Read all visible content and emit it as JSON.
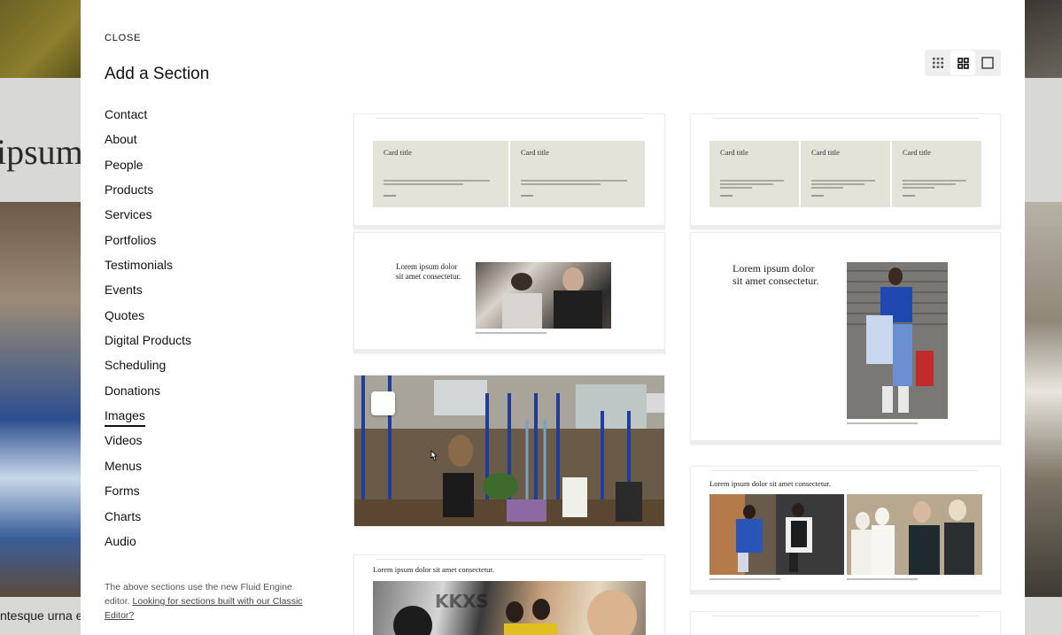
{
  "background": {
    "fragment_heading": "ipsum",
    "fragment_body": "ntesque urna e"
  },
  "modal": {
    "close_label": "CLOSE",
    "title": "Add a Section",
    "view_options": [
      {
        "icon": "grid-small-icon",
        "selected": false
      },
      {
        "icon": "grid-medium-icon",
        "selected": true
      },
      {
        "icon": "grid-single-icon",
        "selected": false
      }
    ],
    "categories": [
      {
        "label": "Contact",
        "active": false
      },
      {
        "label": "About",
        "active": false
      },
      {
        "label": "People",
        "active": false
      },
      {
        "label": "Products",
        "active": false
      },
      {
        "label": "Services",
        "active": false
      },
      {
        "label": "Portfolios",
        "active": false
      },
      {
        "label": "Testimonials",
        "active": false
      },
      {
        "label": "Events",
        "active": false
      },
      {
        "label": "Quotes",
        "active": false
      },
      {
        "label": "Digital Products",
        "active": false
      },
      {
        "label": "Scheduling",
        "active": false
      },
      {
        "label": "Donations",
        "active": false
      },
      {
        "label": "Images",
        "active": true
      },
      {
        "label": "Videos",
        "active": false
      },
      {
        "label": "Menus",
        "active": false
      },
      {
        "label": "Forms",
        "active": false
      },
      {
        "label": "Charts",
        "active": false
      },
      {
        "label": "Audio",
        "active": false
      }
    ],
    "footnote": {
      "text": "The above sections use the new Fluid Engine editor.",
      "link": "Looking for sections built with our Classic Editor?"
    }
  },
  "previews": {
    "card_title": "Card title",
    "headline": "Lorem ipsum dolor sit amet consectetur.",
    "headline_line1": "Lorem ipsum dolor",
    "headline_line2": "sit amet consectetur."
  },
  "colors": {
    "tile_bg": "#e3e3da",
    "text_dark": "#111111",
    "modal_bg": "#ffffff"
  }
}
